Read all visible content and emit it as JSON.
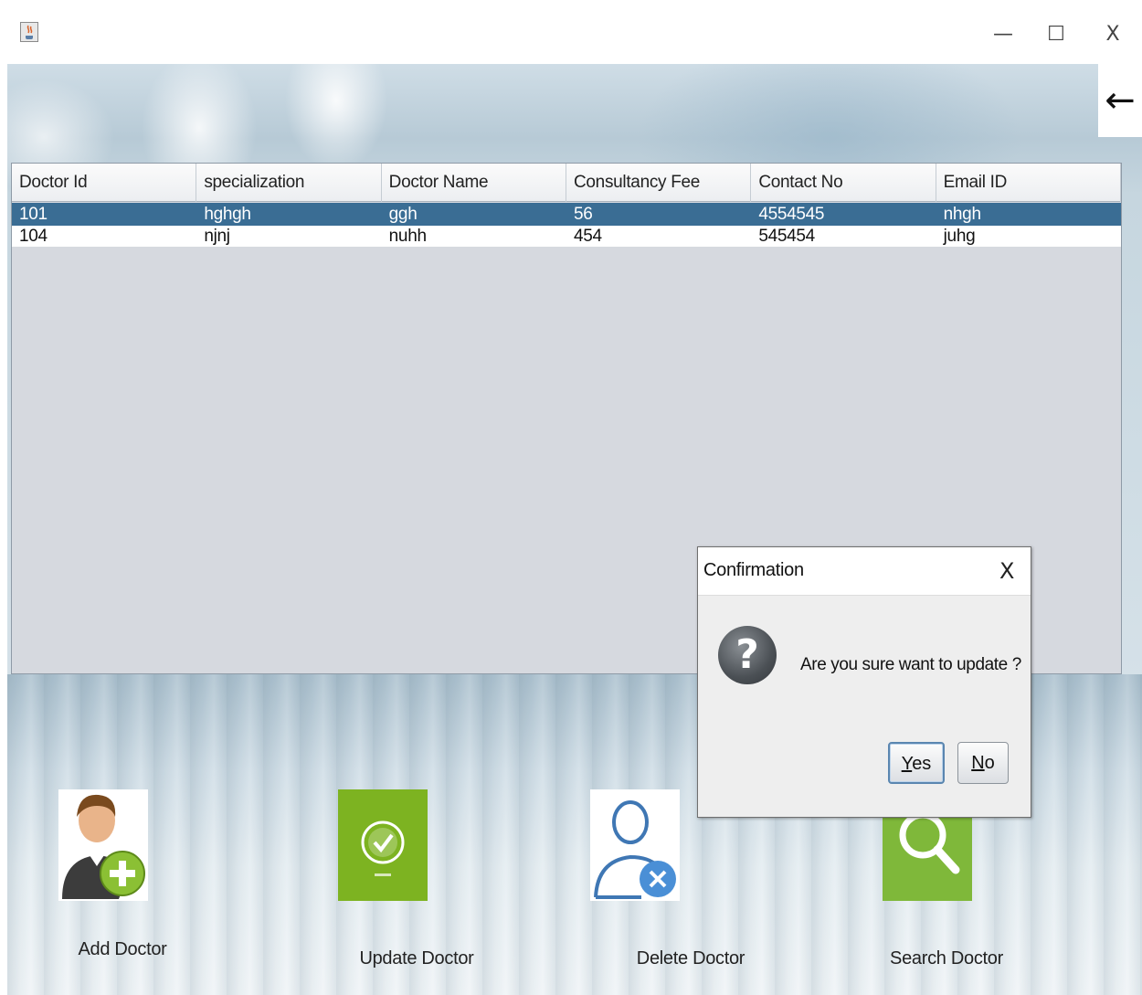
{
  "window": {
    "minimize_glyph": "—",
    "maximize_glyph": "☐",
    "close_glyph": "X",
    "icon": "java-cup-icon"
  },
  "back_button": {
    "glyph": "←",
    "icon": "arrow-left-icon"
  },
  "table": {
    "columns": [
      "Doctor Id",
      "specialization",
      "Doctor Name",
      "Consultancy Fee",
      "Contact No",
      "Email ID"
    ],
    "rows": [
      [
        "101",
        "hghgh",
        "ggh",
        "56",
        "4554545",
        "nhgh"
      ],
      [
        "104",
        "njnj",
        "nuhh",
        "454",
        "545454",
        "juhg"
      ]
    ],
    "selected_row_index": 0
  },
  "actions": [
    {
      "label": "Add Doctor",
      "icon": "add-user-icon"
    },
    {
      "label": "Update Doctor",
      "icon": "update-check-icon"
    },
    {
      "label": "Delete Doctor",
      "icon": "delete-user-icon"
    },
    {
      "label": "Search Doctor",
      "icon": "search-icon"
    }
  ],
  "dialog": {
    "title": "Confirmation",
    "close_glyph": "X",
    "question_glyph": "?",
    "message": "Are you sure want to update ?",
    "yes_mnemonic": "Y",
    "yes_rest": "es",
    "no_mnemonic": "N",
    "no_rest": "o"
  },
  "colors": {
    "selected_row": "#3a6d94",
    "tile_green": "#8bc034",
    "update_tile_green": "#7db321"
  }
}
